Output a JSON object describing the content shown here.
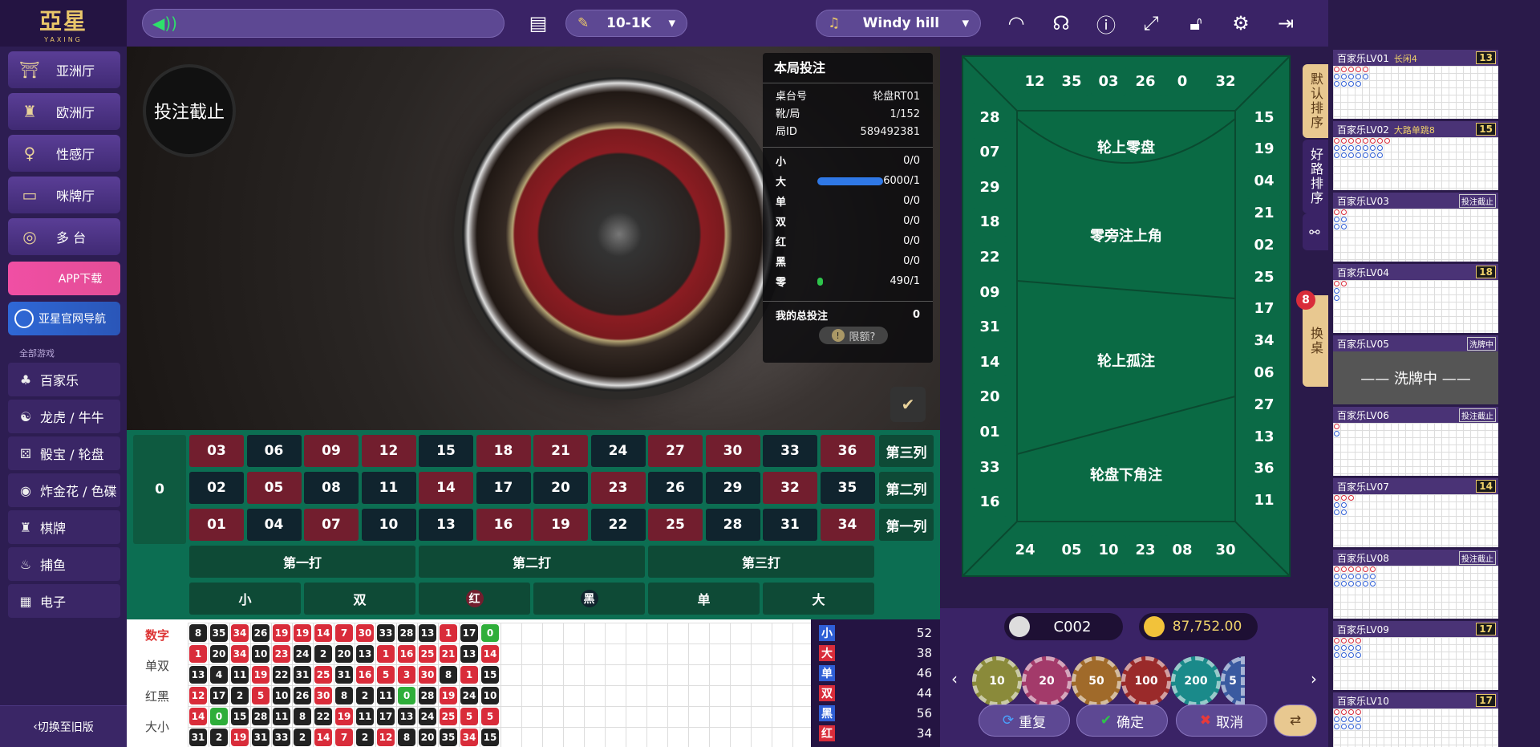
{
  "brand": {
    "name": "亞星",
    "sub": "YAXING"
  },
  "sidebar": {
    "halls": [
      {
        "label": "亚洲厅",
        "icon": "pagoda-icon"
      },
      {
        "label": "欧洲厅",
        "icon": "tower-icon"
      },
      {
        "label": "性感厅",
        "icon": "dancer-icon"
      },
      {
        "label": "咪牌厅",
        "icon": "cards-icon"
      },
      {
        "label": "多 台",
        "icon": "gamepad-icon"
      }
    ],
    "app_download": "APP下载",
    "site_nav": "亚星官网导航",
    "category_label": "全部游戏",
    "categories": [
      {
        "label": "百家乐",
        "icon": "♣"
      },
      {
        "label": "龙虎 / 牛牛",
        "icon": "☯"
      },
      {
        "label": "骰宝 / 轮盘",
        "icon": "⚄"
      },
      {
        "label": "炸金花 / 色碟",
        "icon": "◉"
      },
      {
        "label": "棋牌",
        "icon": "♜"
      },
      {
        "label": "捕鱼",
        "icon": "♨"
      },
      {
        "label": "电子",
        "icon": "▦"
      }
    ],
    "old_version": "切换至旧版"
  },
  "topbar": {
    "limit": "10-1K",
    "music": "Windy hill"
  },
  "video": {
    "stop_badge": "投注截止"
  },
  "bet_panel": {
    "title": "本局投注",
    "rows": [
      {
        "k": "桌台号",
        "v": "轮盘RT01"
      },
      {
        "k": "靴/局",
        "v": "1/152"
      },
      {
        "k": "局ID",
        "v": "589492381"
      }
    ],
    "stats": [
      {
        "k": "小",
        "v": "0/0",
        "fill": 0
      },
      {
        "k": "大",
        "v": "6000/1",
        "fill": 1
      },
      {
        "k": "单",
        "v": "0/0",
        "fill": 0
      },
      {
        "k": "双",
        "v": "0/0",
        "fill": 0
      },
      {
        "k": "红",
        "v": "0/0",
        "fill": 0
      },
      {
        "k": "黑",
        "v": "0/0",
        "fill": 0
      },
      {
        "k": "零",
        "v": "490/1",
        "fill": 0.08
      }
    ],
    "my_total_label": "我的总投注",
    "my_total": "0",
    "limit_q": "限额?"
  },
  "board": {
    "zero": "0",
    "rows": [
      [
        {
          "n": "03",
          "c": "red"
        },
        {
          "n": "06",
          "c": "blk"
        },
        {
          "n": "09",
          "c": "red"
        },
        {
          "n": "12",
          "c": "red"
        },
        {
          "n": "15",
          "c": "blk"
        },
        {
          "n": "18",
          "c": "red"
        },
        {
          "n": "21",
          "c": "red"
        },
        {
          "n": "24",
          "c": "blk"
        },
        {
          "n": "27",
          "c": "red"
        },
        {
          "n": "30",
          "c": "red"
        },
        {
          "n": "33",
          "c": "blk"
        },
        {
          "n": "36",
          "c": "red"
        }
      ],
      [
        {
          "n": "02",
          "c": "blk"
        },
        {
          "n": "05",
          "c": "red"
        },
        {
          "n": "08",
          "c": "blk"
        },
        {
          "n": "11",
          "c": "blk"
        },
        {
          "n": "14",
          "c": "red"
        },
        {
          "n": "17",
          "c": "blk"
        },
        {
          "n": "20",
          "c": "blk"
        },
        {
          "n": "23",
          "c": "red"
        },
        {
          "n": "26",
          "c": "blk"
        },
        {
          "n": "29",
          "c": "blk"
        },
        {
          "n": "32",
          "c": "red"
        },
        {
          "n": "35",
          "c": "blk"
        }
      ],
      [
        {
          "n": "01",
          "c": "red"
        },
        {
          "n": "04",
          "c": "blk"
        },
        {
          "n": "07",
          "c": "red"
        },
        {
          "n": "10",
          "c": "blk"
        },
        {
          "n": "13",
          "c": "blk"
        },
        {
          "n": "16",
          "c": "red"
        },
        {
          "n": "19",
          "c": "red"
        },
        {
          "n": "22",
          "c": "blk"
        },
        {
          "n": "25",
          "c": "red"
        },
        {
          "n": "28",
          "c": "blk"
        },
        {
          "n": "31",
          "c": "blk"
        },
        {
          "n": "34",
          "c": "red"
        }
      ]
    ],
    "columns": [
      "第三列",
      "第二列",
      "第一列"
    ],
    "dozens": [
      "第一打",
      "第二打",
      "第三打"
    ],
    "outside": [
      "小",
      "双",
      "红",
      "黑",
      "单",
      "大"
    ]
  },
  "road": {
    "tabs": [
      "数字",
      "单双",
      "红黑",
      "大小"
    ],
    "rows": [
      [
        [
          "8",
          "b"
        ],
        [
          "35",
          "b"
        ],
        [
          "34",
          "r"
        ],
        [
          "26",
          "b"
        ],
        [
          "19",
          "r"
        ],
        [
          "19",
          "r"
        ],
        [
          "14",
          "r"
        ],
        [
          "7",
          "r"
        ],
        [
          "30",
          "r"
        ],
        [
          "33",
          "b"
        ],
        [
          "28",
          "b"
        ],
        [
          "13",
          "b"
        ],
        [
          "1",
          "r"
        ],
        [
          "17",
          "b"
        ],
        [
          "0",
          "g"
        ]
      ],
      [
        [
          "1",
          "r"
        ],
        [
          "20",
          "b"
        ],
        [
          "34",
          "r"
        ],
        [
          "10",
          "b"
        ],
        [
          "23",
          "r"
        ],
        [
          "24",
          "b"
        ],
        [
          "2",
          "b"
        ],
        [
          "20",
          "b"
        ],
        [
          "13",
          "b"
        ],
        [
          "1",
          "r"
        ],
        [
          "16",
          "r"
        ],
        [
          "25",
          "r"
        ],
        [
          "21",
          "r"
        ],
        [
          "13",
          "b"
        ],
        [
          "14",
          "r"
        ]
      ],
      [
        [
          "13",
          "b"
        ],
        [
          "4",
          "b"
        ],
        [
          "11",
          "b"
        ],
        [
          "19",
          "r"
        ],
        [
          "22",
          "b"
        ],
        [
          "31",
          "b"
        ],
        [
          "25",
          "r"
        ],
        [
          "31",
          "b"
        ],
        [
          "16",
          "r"
        ],
        [
          "5",
          "r"
        ],
        [
          "3",
          "r"
        ],
        [
          "30",
          "r"
        ],
        [
          "8",
          "b"
        ],
        [
          "1",
          "r"
        ],
        [
          "15",
          "b"
        ]
      ],
      [
        [
          "12",
          "r"
        ],
        [
          "17",
          "b"
        ],
        [
          "2",
          "b"
        ],
        [
          "5",
          "r"
        ],
        [
          "10",
          "b"
        ],
        [
          "26",
          "b"
        ],
        [
          "30",
          "r"
        ],
        [
          "8",
          "b"
        ],
        [
          "2",
          "b"
        ],
        [
          "11",
          "b"
        ],
        [
          "0",
          "g"
        ],
        [
          "28",
          "b"
        ],
        [
          "19",
          "r"
        ],
        [
          "24",
          "b"
        ],
        [
          "10",
          "b"
        ]
      ],
      [
        [
          "14",
          "r"
        ],
        [
          "0",
          "g"
        ],
        [
          "15",
          "b"
        ],
        [
          "28",
          "b"
        ],
        [
          "11",
          "b"
        ],
        [
          "8",
          "b"
        ],
        [
          "22",
          "b"
        ],
        [
          "19",
          "r"
        ],
        [
          "11",
          "b"
        ],
        [
          "17",
          "b"
        ],
        [
          "13",
          "b"
        ],
        [
          "24",
          "b"
        ],
        [
          "25",
          "r"
        ],
        [
          "5",
          "r"
        ],
        [
          "5",
          "r"
        ]
      ],
      [
        [
          "31",
          "b"
        ],
        [
          "2",
          "b"
        ],
        [
          "19",
          "r"
        ],
        [
          "31",
          "b"
        ],
        [
          "33",
          "b"
        ],
        [
          "2",
          "b"
        ],
        [
          "14",
          "r"
        ],
        [
          "7",
          "r"
        ],
        [
          "2",
          "b"
        ],
        [
          "12",
          "r"
        ],
        [
          "8",
          "b"
        ],
        [
          "20",
          "b"
        ],
        [
          "35",
          "b"
        ],
        [
          "34",
          "r"
        ],
        [
          "15",
          "b"
        ]
      ]
    ],
    "stats": [
      {
        "k": "小",
        "v": "52",
        "c": "#2f5fd6"
      },
      {
        "k": "大",
        "v": "38",
        "c": "#d92c3a"
      },
      {
        "k": "单",
        "v": "46",
        "c": "#2f5fd6"
      },
      {
        "k": "双",
        "v": "44",
        "c": "#d92c3a"
      },
      {
        "k": "黑",
        "v": "56",
        "c": "#2f5fd6"
      },
      {
        "k": "红",
        "v": "34",
        "c": "#d92c3a"
      }
    ]
  },
  "track": {
    "top": [
      "12",
      "35",
      "03",
      "26",
      "0",
      "32"
    ],
    "left": [
      "28",
      "07",
      "29",
      "18",
      "22",
      "09",
      "31",
      "14",
      "20",
      "01",
      "33",
      "16"
    ],
    "right": [
      "15",
      "19",
      "04",
      "21",
      "02",
      "25",
      "17",
      "34",
      "06",
      "27",
      "13",
      "36",
      "11"
    ],
    "bottom": [
      "24",
      "05",
      "10",
      "23",
      "08",
      "30"
    ],
    "sections": [
      "轮上零盘",
      "零旁注上角",
      "轮上孤注",
      "轮盘下角注"
    ]
  },
  "side_tabs": {
    "default_sort": "默认排序",
    "good_road": "好路排序",
    "change_table": "换桌",
    "badge": "8"
  },
  "player": {
    "name": "C002",
    "balance": "87,752.00"
  },
  "chips": [
    "10",
    "20",
    "50",
    "100",
    "200",
    "5"
  ],
  "actions": {
    "repeat": "重复",
    "confirm": "确定",
    "cancel": "取消"
  },
  "tables": [
    {
      "name": "百家乐LV01",
      "tag": "长闲4",
      "count": "13",
      "status": ""
    },
    {
      "name": "百家乐LV02",
      "tag": "大路单跳8",
      "count": "15",
      "status": ""
    },
    {
      "name": "百家乐LV03",
      "tag": "",
      "count": "",
      "status": "投注截止"
    },
    {
      "name": "百家乐LV04",
      "tag": "",
      "count": "18",
      "status": ""
    },
    {
      "name": "百家乐LV05",
      "tag": "",
      "count": "",
      "status": "洗牌中",
      "shuffle": "—— 洗牌中 ——"
    },
    {
      "name": "百家乐LV06",
      "tag": "",
      "count": "",
      "status": "投注截止"
    },
    {
      "name": "百家乐LV07",
      "tag": "",
      "count": "14",
      "status": ""
    },
    {
      "name": "百家乐LV08",
      "tag": "",
      "count": "",
      "status": "投注截止"
    },
    {
      "name": "百家乐LV09",
      "tag": "",
      "count": "17",
      "status": ""
    },
    {
      "name": "百家乐LV10",
      "tag": "",
      "count": "17",
      "status": ""
    }
  ]
}
